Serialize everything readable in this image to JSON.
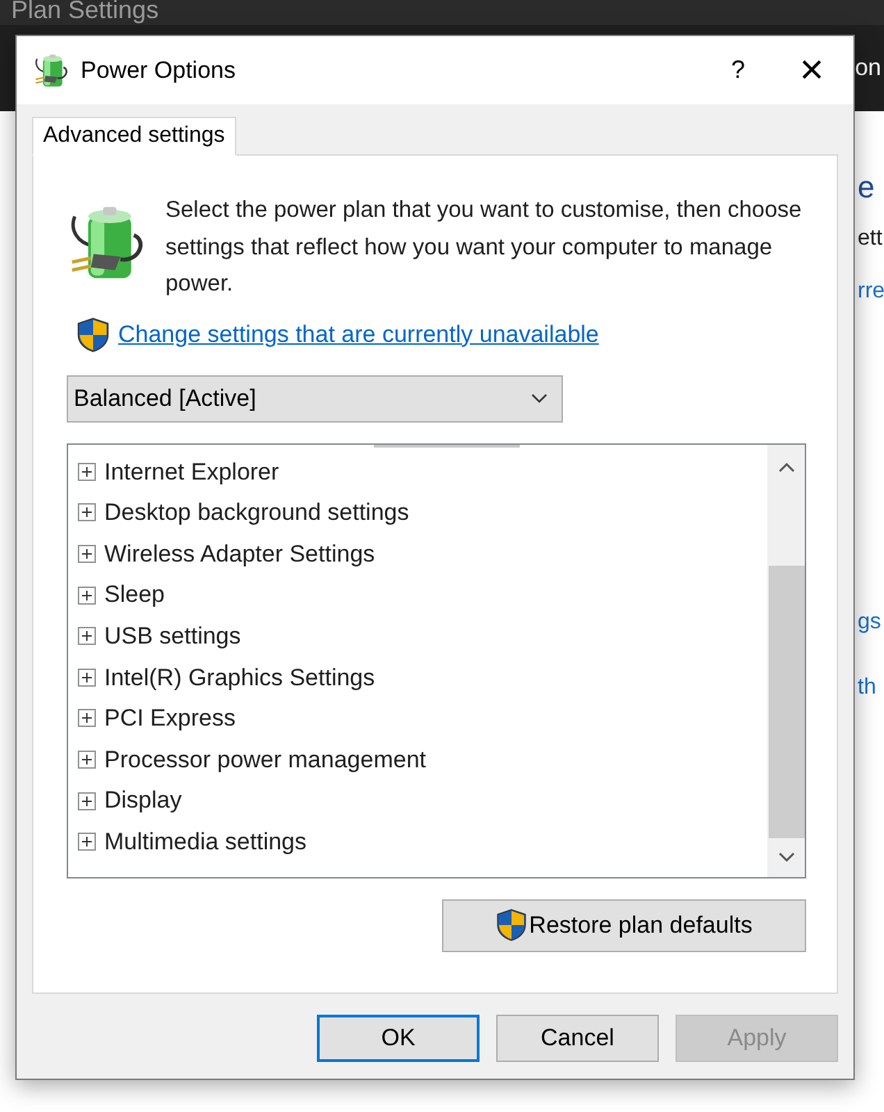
{
  "background": {
    "title": "Plan Settings",
    "toolbar_fragment": "on",
    "fragments": [
      "e",
      "ett",
      "rre",
      "gs",
      "th"
    ]
  },
  "window": {
    "title": "Power Options",
    "help": "?",
    "close": "×"
  },
  "tabs": [
    {
      "label": "Advanced settings",
      "selected": true
    }
  ],
  "description": "Select the power plan that you want to customise, then choose settings that reflect how you want your computer to manage power.",
  "link": "Change settings that are currently unavailable",
  "plan_dropdown": {
    "value": "Balanced [Active]"
  },
  "settings": [
    {
      "label": "Internet Explorer",
      "expanded": false
    },
    {
      "label": "Desktop background settings",
      "expanded": false
    },
    {
      "label": "Wireless Adapter Settings",
      "expanded": false
    },
    {
      "label": "Sleep",
      "expanded": false
    },
    {
      "label": "USB settings",
      "expanded": false
    },
    {
      "label": "Intel(R) Graphics Settings",
      "expanded": false
    },
    {
      "label": "PCI Express",
      "expanded": false
    },
    {
      "label": "Processor power management",
      "expanded": false
    },
    {
      "label": "Display",
      "expanded": false
    },
    {
      "label": "Multimedia settings",
      "expanded": false
    }
  ],
  "restore_button": "Restore plan defaults",
  "buttons": [
    {
      "label": "OK",
      "default": true,
      "disabled": false
    },
    {
      "label": "Cancel",
      "default": false,
      "disabled": false
    },
    {
      "label": "Apply",
      "default": false,
      "disabled": true
    }
  ]
}
